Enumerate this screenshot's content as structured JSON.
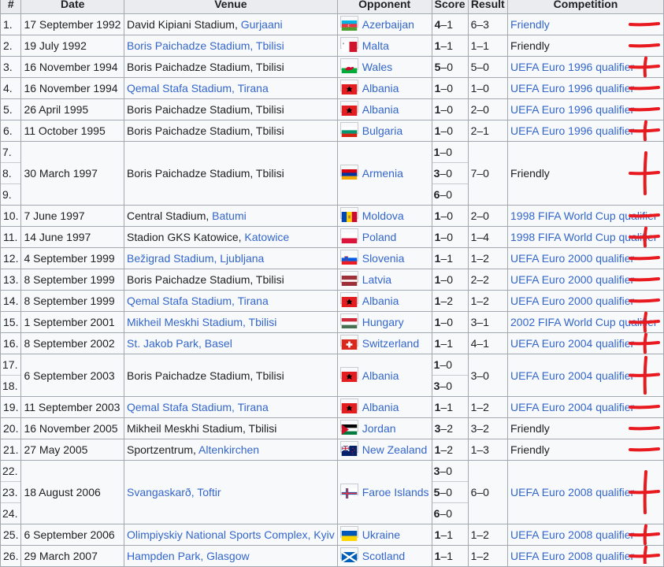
{
  "headers": [
    "#",
    "Date",
    "Venue",
    "Opponent",
    "Score",
    "Result",
    "Competition"
  ],
  "rows": [
    {
      "date": "17 September 1992",
      "venue": [
        {
          "t": "David Kipiani Stadium, "
        },
        {
          "t": "Gurjaani",
          "link": true
        }
      ],
      "flag": "azerbaijan",
      "opponent": "Azerbaijan",
      "scores": [
        {
          "n": "1.",
          "w": "4",
          "r": "–1"
        }
      ],
      "result": "6–3",
      "comp": "Friendly",
      "comp_link": true,
      "mark": "minus"
    },
    {
      "date": "19 July 1992",
      "venue": [
        {
          "t": "Boris Paichadze Stadium, Tbilisi",
          "link": true
        }
      ],
      "flag": "malta",
      "opponent": "Malta",
      "scores": [
        {
          "n": "2.",
          "w": "1",
          "r": "–1"
        }
      ],
      "result": "1–1",
      "comp": "Friendly",
      "comp_link": false,
      "mark": "minus"
    },
    {
      "date": "16 November 1994",
      "venue": [
        {
          "t": "Boris Paichadze Stadium, Tbilisi"
        }
      ],
      "flag": "wales",
      "opponent": "Wales",
      "scores": [
        {
          "n": "3.",
          "w": "5",
          "r": "–0"
        }
      ],
      "result": "5–0",
      "comp": "UEFA Euro 1996 qualifier",
      "comp_link": true,
      "mark": "plus"
    },
    {
      "date": "16 November 1994",
      "venue": [
        {
          "t": "Qemal Stafa Stadium, Tirana",
          "link": true
        }
      ],
      "flag": "albania",
      "opponent": "Albania",
      "scores": [
        {
          "n": "4.",
          "w": "1",
          "r": "–0"
        }
      ],
      "result": "1–0",
      "comp": "UEFA Euro 1996 qualifier",
      "comp_link": true,
      "mark": "minus"
    },
    {
      "date": "26 April 1995",
      "venue": [
        {
          "t": "Boris Paichadze Stadium, Tbilisi"
        }
      ],
      "flag": "albania",
      "opponent": "Albania",
      "scores": [
        {
          "n": "5.",
          "w": "1",
          "r": "–0"
        }
      ],
      "result": "2–0",
      "comp": "UEFA Euro 1996 qualifier",
      "comp_link": true,
      "mark": "minus"
    },
    {
      "date": "11 October 1995",
      "venue": [
        {
          "t": "Boris Paichadze Stadium, Tbilisi"
        }
      ],
      "flag": "bulgaria",
      "opponent": "Bulgaria",
      "scores": [
        {
          "n": "6.",
          "w": "1",
          "r": "–0"
        }
      ],
      "result": "2–1",
      "comp": "UEFA Euro 1996 qualifier",
      "comp_link": true,
      "mark": "plus"
    },
    {
      "date": "30 March 1997",
      "venue": [
        {
          "t": "Boris Paichadze Stadium, Tbilisi"
        }
      ],
      "flag": "armenia",
      "opponent": "Armenia",
      "scores": [
        {
          "n": "7.",
          "w": "1",
          "r": "–0"
        },
        {
          "n": "8.",
          "w": "3",
          "r": "–0"
        },
        {
          "n": "9.",
          "w": "6",
          "r": "–0"
        }
      ],
      "result": "7–0",
      "comp": "Friendly",
      "comp_link": false,
      "mark": "plus"
    },
    {
      "date": "7 June 1997",
      "venue": [
        {
          "t": "Central Stadium, "
        },
        {
          "t": "Batumi",
          "link": true
        }
      ],
      "flag": "moldova",
      "opponent": "Moldova",
      "scores": [
        {
          "n": "10.",
          "w": "1",
          "r": "–0"
        }
      ],
      "result": "2–0",
      "comp": "1998 FIFA World Cup qualifier",
      "comp_link": true,
      "mark": "minus"
    },
    {
      "date": "14 June 1997",
      "venue": [
        {
          "t": "Stadion GKS Katowice, "
        },
        {
          "t": "Katowice",
          "link": true
        }
      ],
      "flag": "poland",
      "opponent": "Poland",
      "scores": [
        {
          "n": "11.",
          "w": "1",
          "r": "–0"
        }
      ],
      "result": "1–4",
      "comp": "1998 FIFA World Cup qualifier",
      "comp_link": true,
      "mark": "plus"
    },
    {
      "date": "4 September 1999",
      "venue": [
        {
          "t": "Bežigrad Stadium, Ljubljana",
          "link": true
        }
      ],
      "flag": "slovenia",
      "opponent": "Slovenia",
      "scores": [
        {
          "n": "12.",
          "w": "1",
          "r": "–1"
        }
      ],
      "result": "1–2",
      "comp": "UEFA Euro 2000 qualifier",
      "comp_link": true,
      "mark": "minus"
    },
    {
      "date": "8 September 1999",
      "venue": [
        {
          "t": "Boris Paichadze Stadium, Tbilisi"
        }
      ],
      "flag": "latvia",
      "opponent": "Latvia",
      "scores": [
        {
          "n": "13.",
          "w": "1",
          "r": "–0"
        }
      ],
      "result": "2–2",
      "comp": "UEFA Euro 2000 qualifier",
      "comp_link": true,
      "mark": "minus"
    },
    {
      "date": "8 September 1999",
      "venue": [
        {
          "t": "Qemal Stafa Stadium, Tirana",
          "link": true
        }
      ],
      "flag": "albania",
      "opponent": "Albania",
      "scores": [
        {
          "n": "14.",
          "w": "1",
          "r": "–2"
        }
      ],
      "result": "1–2",
      "comp": "UEFA Euro 2000 qualifier",
      "comp_link": true,
      "mark": "minus"
    },
    {
      "date": "1 September 2001",
      "venue": [
        {
          "t": "Mikheil Meskhi Stadium, Tbilisi",
          "link": true
        }
      ],
      "flag": "hungary",
      "opponent": "Hungary",
      "scores": [
        {
          "n": "15.",
          "w": "1",
          "r": "–0"
        }
      ],
      "result": "3–1",
      "comp": "2002 FIFA World Cup qualifier",
      "comp_link": true,
      "mark": "plus"
    },
    {
      "date": "8 September 2002",
      "venue": [
        {
          "t": "St. Jakob Park, Basel",
          "link": true
        }
      ],
      "flag": "switzerland",
      "opponent": "Switzerland",
      "scores": [
        {
          "n": "16.",
          "w": "1",
          "r": "–1"
        }
      ],
      "result": "4–1",
      "comp": "UEFA Euro 2004 qualifier",
      "comp_link": true,
      "mark": "plus"
    },
    {
      "date": "6 September 2003",
      "venue": [
        {
          "t": "Boris Paichadze Stadium, Tbilisi"
        }
      ],
      "flag": "albania",
      "opponent": "Albania",
      "scores": [
        {
          "n": "17.",
          "w": "1",
          "r": "–0"
        },
        {
          "n": "18.",
          "w": "3",
          "r": "–0"
        }
      ],
      "result": "3–0",
      "comp": "UEFA Euro 2004 qualifier",
      "comp_link": true,
      "mark": "plus"
    },
    {
      "date": "11 September 2003",
      "venue": [
        {
          "t": "Qemal Stafa Stadium, Tirana",
          "link": true
        }
      ],
      "flag": "albania",
      "opponent": "Albania",
      "scores": [
        {
          "n": "19.",
          "w": "1",
          "r": "–1"
        }
      ],
      "result": "1–2",
      "comp": "UEFA Euro 2004 qualifier",
      "comp_link": true,
      "mark": "minus"
    },
    {
      "date": "16 November 2005",
      "venue": [
        {
          "t": "Mikheil Meskhi Stadium, Tbilisi"
        }
      ],
      "flag": "jordan",
      "opponent": "Jordan",
      "scores": [
        {
          "n": "20.",
          "w": "3",
          "r": "–2"
        }
      ],
      "result": "3–2",
      "comp": "Friendly",
      "comp_link": false,
      "mark": "minus"
    },
    {
      "date": "27 May 2005",
      "venue": [
        {
          "t": "Sportzentrum, "
        },
        {
          "t": "Altenkirchen",
          "link": true
        }
      ],
      "flag": "newzealand",
      "opponent": "New Zealand",
      "scores": [
        {
          "n": "21.",
          "w": "1",
          "r": "–2"
        }
      ],
      "result": "1–3",
      "comp": "Friendly",
      "comp_link": false,
      "mark": "minus"
    },
    {
      "date": "18 August 2006",
      "venue": [
        {
          "t": "Svangaskarð, Toftir",
          "link": true
        }
      ],
      "flag": "faroe",
      "opponent": "Faroe Islands",
      "scores": [
        {
          "n": "22.",
          "w": "3",
          "r": "–0"
        },
        {
          "n": "23.",
          "w": "5",
          "r": "–0"
        },
        {
          "n": "24.",
          "w": "6",
          "r": "–0"
        }
      ],
      "result": "6–0",
      "comp": "UEFA Euro 2008 qualifier",
      "comp_link": true,
      "mark": "plus"
    },
    {
      "date": "6 September 2006",
      "venue": [
        {
          "t": "Olimpiyskiy National Sports Complex, Kyiv",
          "link": true
        }
      ],
      "flag": "ukraine",
      "opponent": "Ukraine",
      "scores": [
        {
          "n": "25.",
          "w": "1",
          "r": "–1"
        }
      ],
      "result": "1–2",
      "comp": "UEFA Euro 2008 qualifier",
      "comp_link": true,
      "mark": "plus"
    },
    {
      "date": "29 March 2007",
      "venue": [
        {
          "t": "Hampden Park, Glasgow",
          "link": true
        }
      ],
      "flag": "scotland",
      "opponent": "Scotland",
      "scores": [
        {
          "n": "26.",
          "w": "1",
          "r": "–1"
        }
      ],
      "result": "1–2",
      "comp": "UEFA Euro 2008 qualifier",
      "comp_link": true,
      "mark": "plus"
    }
  ],
  "colors": {
    "link": "#3366cc",
    "text": "#202122",
    "header_bg": "#eaecf0",
    "cell_bg": "#f8f9fa",
    "border": "#a2a9b1",
    "annotation": "#e8191f"
  },
  "annotation_symbols": [
    "plus",
    "minus"
  ]
}
